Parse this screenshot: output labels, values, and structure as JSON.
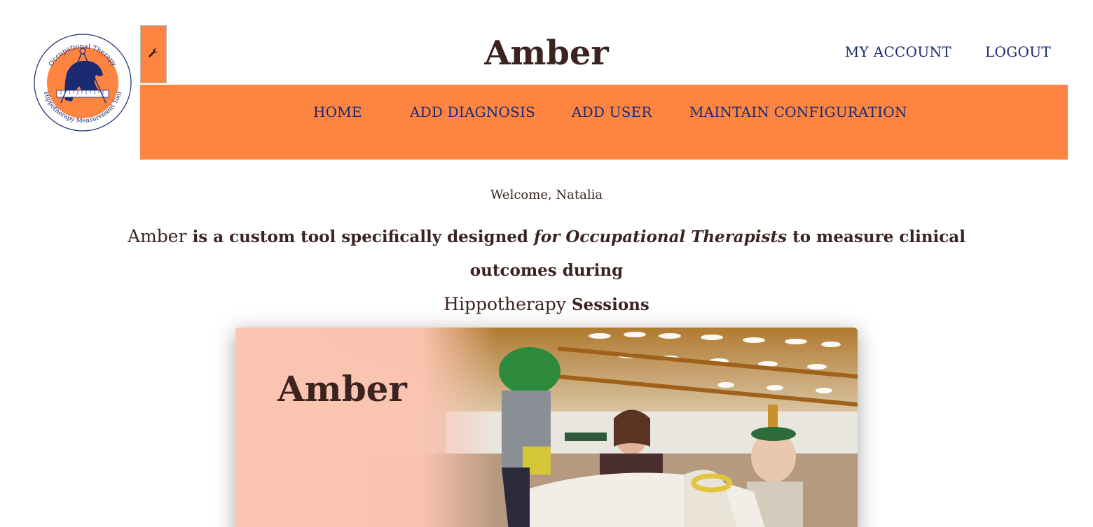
{
  "header": {
    "app_title": "Amber",
    "logo": {
      "ring_text_top": "Occupational Therapy",
      "ring_text_bottom": "Hippotherapy Measurement Tool",
      "icon": "horse-measurement-logo"
    },
    "admin_icon": "wrench-icon",
    "links": {
      "my_account": "MY ACCOUNT",
      "logout": "LOGOUT"
    }
  },
  "nav": {
    "items": [
      {
        "label": "HOME"
      },
      {
        "label": "ADD DIAGNOSIS"
      },
      {
        "label": "ADD USER"
      },
      {
        "label": "MAINTAIN CONFIGURATION"
      }
    ]
  },
  "main": {
    "welcome": "Welcome, Natalia",
    "tagline": {
      "part1": "Amber",
      "part2": " is a custom tool specifically designed ",
      "part3": "for",
      "part4": " Occupational Therapists",
      "part5": " to measure clinical outcomes during",
      "part6": "Hippotherapy",
      "part7": " Sessions"
    },
    "hero": {
      "title": "Amber",
      "image": "hippotherapy-session-photo"
    }
  },
  "colors": {
    "accent_orange": "#fd8541",
    "nav_text": "#1a2a73",
    "title_text": "#3b2320",
    "hero_overlay": "#fcc5b3"
  }
}
